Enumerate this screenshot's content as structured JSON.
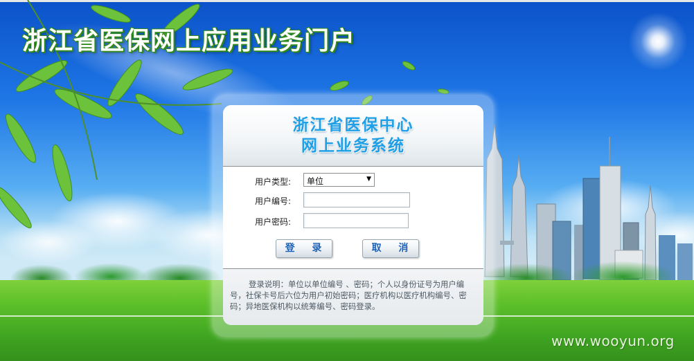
{
  "portal": {
    "title": "浙江省医保网上应用业务门户"
  },
  "login_panel": {
    "system_title_line1": "浙江省医保中心",
    "system_title_line2": "网上业务系统",
    "user_type_label": "用户类型:",
    "user_type_selected": "单位",
    "user_id_label": "用户编号:",
    "user_id_value": "",
    "password_label": "用户密码:",
    "password_value": "",
    "login_button": "登 录",
    "cancel_button": "取 消",
    "note": "登录说明：单位以单位编号 、密码；个人以身份证号为用户编号，社保卡号后六位为用户初始密码；医疗机构以医疗机构编号、密码；异地医保机构以统筹编号、密码登录。"
  },
  "watermark": "www.wooyun.org",
  "colors": {
    "title_green": "#2e8a1a",
    "system_title_blue": "#1f9fe6",
    "button_text": "#1e63b8"
  },
  "icons": {
    "select_arrow": "dropdown-arrow-icon"
  }
}
